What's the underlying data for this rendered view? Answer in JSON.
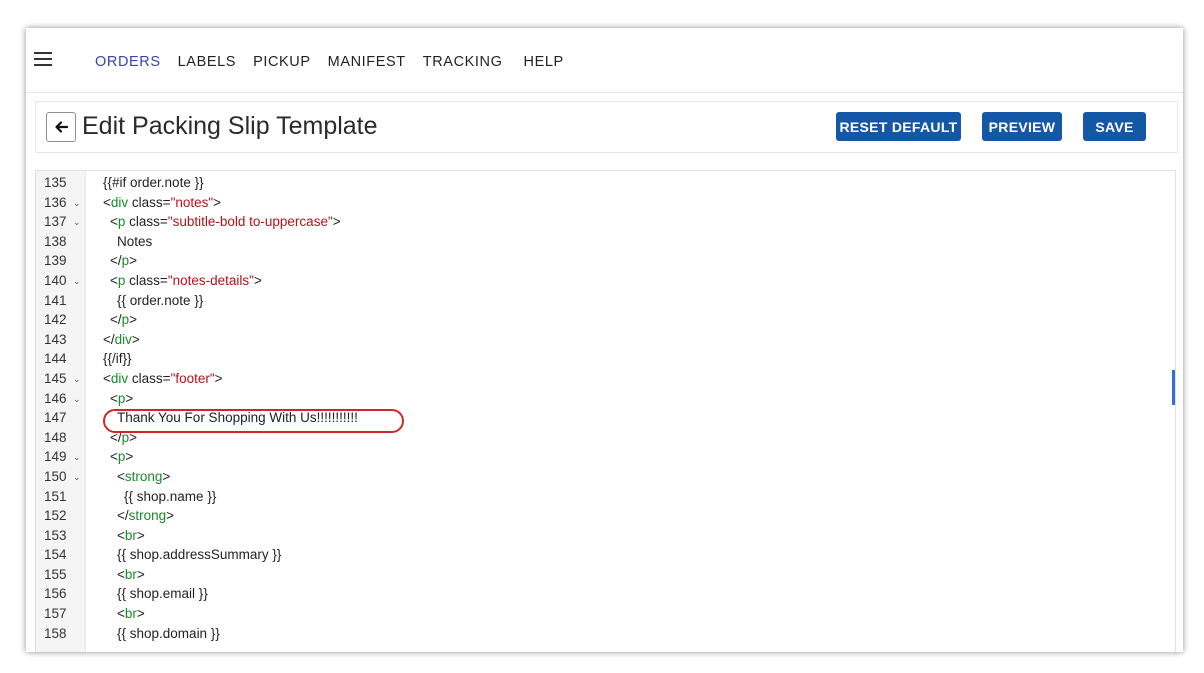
{
  "nav": {
    "items": [
      {
        "label": "ORDERS",
        "active": true
      },
      {
        "label": "LABELS"
      },
      {
        "label": "PICKUP"
      },
      {
        "label": "MANIFEST"
      },
      {
        "label": "TRACKING"
      },
      {
        "label": "HELP"
      }
    ]
  },
  "header": {
    "title": "Edit Packing Slip Template",
    "reset_label": "RESET DEFAULT",
    "preview_label": "PREVIEW",
    "save_label": "SAVE"
  },
  "colors": {
    "accent": "#1457a6",
    "active_nav": "#3b45a6",
    "tag": "#1a8a2a",
    "string": "#b5121b",
    "highlight": "#d0262a"
  },
  "editor": {
    "lines": [
      {
        "n": "135",
        "fold": false,
        "indent": 0,
        "tokens": [
          [
            "t",
            "{{#if order.note }}"
          ]
        ]
      },
      {
        "n": "136",
        "fold": true,
        "indent": 0,
        "tokens": [
          [
            "t",
            "<"
          ],
          [
            "tag",
            "div"
          ],
          [
            "t",
            " class="
          ],
          [
            "str",
            "\"notes\""
          ],
          [
            "t",
            ">"
          ]
        ]
      },
      {
        "n": "137",
        "fold": true,
        "indent": 1,
        "tokens": [
          [
            "t",
            "<"
          ],
          [
            "tag",
            "p"
          ],
          [
            "t",
            " class="
          ],
          [
            "str",
            "\"subtitle-bold to-uppercase\""
          ],
          [
            "t",
            ">"
          ]
        ]
      },
      {
        "n": "138",
        "fold": false,
        "indent": 2,
        "tokens": [
          [
            "t",
            "Notes"
          ]
        ]
      },
      {
        "n": "139",
        "fold": false,
        "indent": 1,
        "tokens": [
          [
            "t",
            "</"
          ],
          [
            "tag",
            "p"
          ],
          [
            "t",
            ">"
          ]
        ]
      },
      {
        "n": "140",
        "fold": true,
        "indent": 1,
        "tokens": [
          [
            "t",
            "<"
          ],
          [
            "tag",
            "p"
          ],
          [
            "t",
            " class="
          ],
          [
            "str",
            "\"notes-details\""
          ],
          [
            "t",
            ">"
          ]
        ]
      },
      {
        "n": "141",
        "fold": false,
        "indent": 2,
        "tokens": [
          [
            "t",
            "{{ order.note }}"
          ]
        ]
      },
      {
        "n": "142",
        "fold": false,
        "indent": 1,
        "tokens": [
          [
            "t",
            "</"
          ],
          [
            "tag",
            "p"
          ],
          [
            "t",
            ">"
          ]
        ]
      },
      {
        "n": "143",
        "fold": false,
        "indent": 0,
        "tokens": [
          [
            "t",
            "</"
          ],
          [
            "tag",
            "div"
          ],
          [
            "t",
            ">"
          ]
        ]
      },
      {
        "n": "144",
        "fold": false,
        "indent": 0,
        "tokens": [
          [
            "t",
            "{{/if}}"
          ]
        ]
      },
      {
        "n": "145",
        "fold": true,
        "indent": 0,
        "tokens": [
          [
            "t",
            "<"
          ],
          [
            "tag",
            "div"
          ],
          [
            "t",
            " class="
          ],
          [
            "str",
            "\"footer\""
          ],
          [
            "t",
            ">"
          ]
        ]
      },
      {
        "n": "146",
        "fold": true,
        "indent": 1,
        "tokens": [
          [
            "t",
            "<"
          ],
          [
            "tag",
            "p"
          ],
          [
            "t",
            ">"
          ]
        ]
      },
      {
        "n": "147",
        "fold": false,
        "indent": 2,
        "tokens": [
          [
            "t",
            "Thank You For Shopping With Us!!!!!!!!!!!"
          ]
        ]
      },
      {
        "n": "148",
        "fold": false,
        "indent": 1,
        "tokens": [
          [
            "t",
            "</"
          ],
          [
            "tag",
            "p"
          ],
          [
            "t",
            ">"
          ]
        ]
      },
      {
        "n": "149",
        "fold": true,
        "indent": 1,
        "tokens": [
          [
            "t",
            "<"
          ],
          [
            "tag",
            "p"
          ],
          [
            "t",
            ">"
          ]
        ]
      },
      {
        "n": "150",
        "fold": true,
        "indent": 2,
        "tokens": [
          [
            "t",
            "<"
          ],
          [
            "tag",
            "strong"
          ],
          [
            "t",
            ">"
          ]
        ]
      },
      {
        "n": "151",
        "fold": false,
        "indent": 3,
        "tokens": [
          [
            "t",
            "{{ shop.name }}"
          ]
        ]
      },
      {
        "n": "152",
        "fold": false,
        "indent": 2,
        "tokens": [
          [
            "t",
            "</"
          ],
          [
            "tag",
            "strong"
          ],
          [
            "t",
            ">"
          ]
        ]
      },
      {
        "n": "153",
        "fold": false,
        "indent": 2,
        "tokens": [
          [
            "t",
            "<"
          ],
          [
            "tag",
            "br"
          ],
          [
            "t",
            ">"
          ]
        ]
      },
      {
        "n": "154",
        "fold": false,
        "indent": 2,
        "tokens": [
          [
            "t",
            "{{ shop.addressSummary }}"
          ]
        ]
      },
      {
        "n": "155",
        "fold": false,
        "indent": 2,
        "tokens": [
          [
            "t",
            "<"
          ],
          [
            "tag",
            "br"
          ],
          [
            "t",
            ">"
          ]
        ]
      },
      {
        "n": "156",
        "fold": false,
        "indent": 2,
        "tokens": [
          [
            "t",
            "{{ shop.email }}"
          ]
        ]
      },
      {
        "n": "157",
        "fold": false,
        "indent": 2,
        "tokens": [
          [
            "t",
            "<"
          ],
          [
            "tag",
            "br"
          ],
          [
            "t",
            ">"
          ]
        ]
      },
      {
        "n": "158",
        "fold": false,
        "indent": 2,
        "tokens": [
          [
            "t",
            "{{ shop.domain }}"
          ]
        ]
      }
    ]
  }
}
